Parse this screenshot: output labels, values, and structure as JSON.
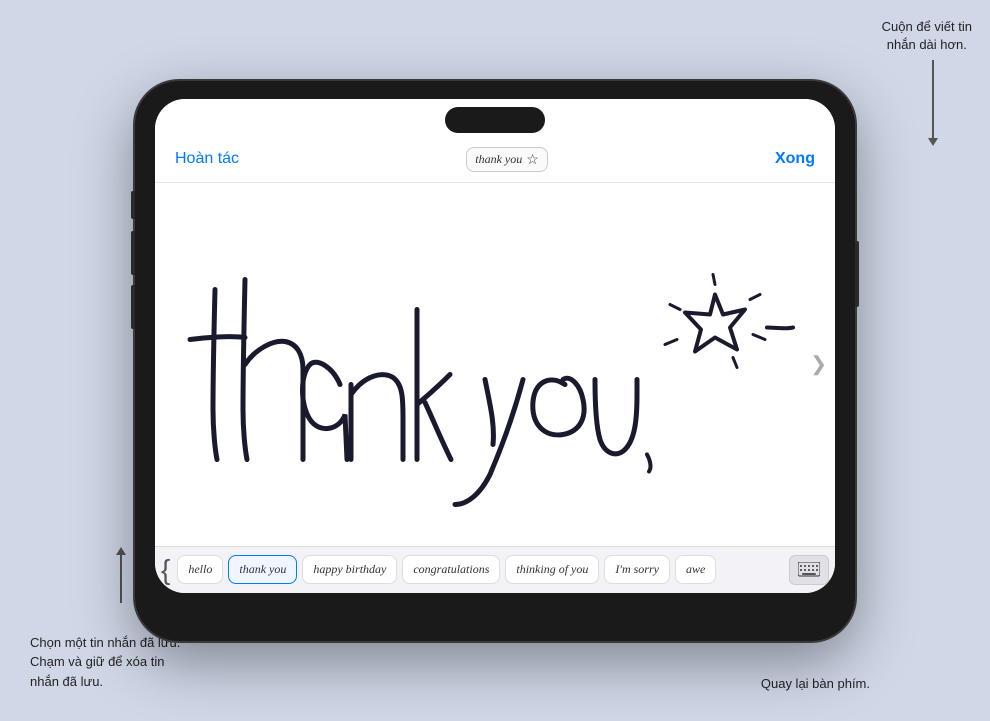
{
  "annotations": {
    "top_right": "Cuộn để viết tin\nnhắn dài hơn.",
    "bottom_left_line1": "Chọn một tin nhắn đã lưu.",
    "bottom_left_line2": "Chạm và giữ để xóa tin",
    "bottom_left_line3": "nhắn đã lưu.",
    "bottom_right": "Quay lại bàn phím."
  },
  "header": {
    "undo_label": "Hoàn tác",
    "done_label": "Xong",
    "preview_text": "thank you",
    "preview_star": "☆"
  },
  "presets": [
    {
      "label": "hello",
      "active": false
    },
    {
      "label": "thank you",
      "active": true
    },
    {
      "label": "happy birthday",
      "active": false
    },
    {
      "label": "congratulations",
      "active": false
    },
    {
      "label": "thinking of you",
      "active": false
    },
    {
      "label": "I'm sorry",
      "active": false
    },
    {
      "label": "awe",
      "active": false
    }
  ],
  "right_arrow": "❯",
  "keyboard_icon": "⌨",
  "bracket": "{"
}
